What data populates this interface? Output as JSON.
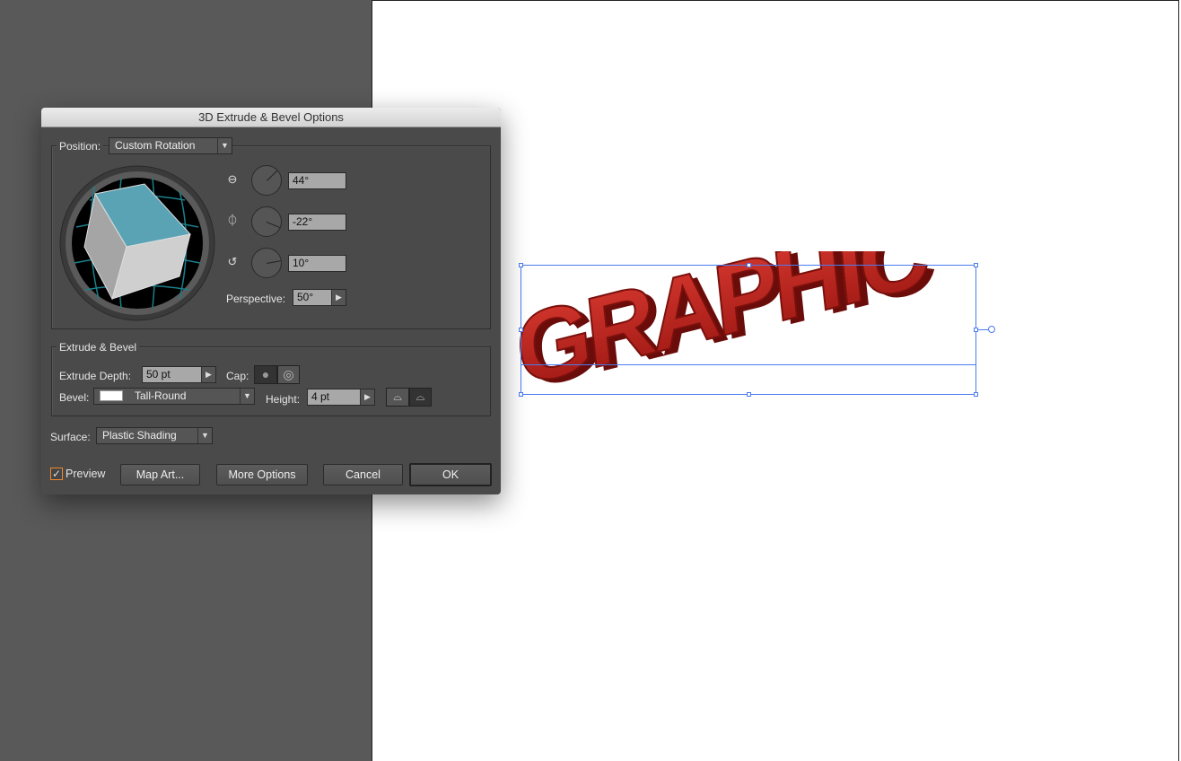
{
  "dialog": {
    "title": "3D Extrude & Bevel Options",
    "position": {
      "label": "Position:",
      "value": "Custom Rotation"
    },
    "rotation": {
      "x": {
        "icon": "x-axis-rotate-icon",
        "value": "44°",
        "angle": 44
      },
      "y": {
        "icon": "y-axis-rotate-icon",
        "value": "-22°",
        "angle": -22
      },
      "z": {
        "icon": "z-axis-rotate-icon",
        "value": "10°",
        "angle": 10
      }
    },
    "perspective": {
      "label": "Perspective:",
      "value": "50°"
    },
    "extrude_bevel": {
      "title": "Extrude & Bevel",
      "depth_label": "Extrude Depth:",
      "depth_value": "50 pt",
      "cap_label": "Cap:",
      "bevel_label": "Bevel:",
      "bevel_value": "Tall-Round",
      "height_label": "Height:",
      "height_value": "4 pt"
    },
    "surface": {
      "label": "Surface:",
      "value": "Plastic Shading"
    },
    "preview": {
      "label": "Preview",
      "checked": true
    },
    "buttons": {
      "map_art": "Map Art...",
      "more_options": "More Options",
      "cancel": "Cancel",
      "ok": "OK"
    }
  },
  "artwork": {
    "text": "GRAPHIC",
    "color": "#b3201b"
  },
  "colors": {
    "cube_top": "#5aa3b5",
    "selection": "#4a7cf0",
    "checkbox": "#f0892a"
  }
}
